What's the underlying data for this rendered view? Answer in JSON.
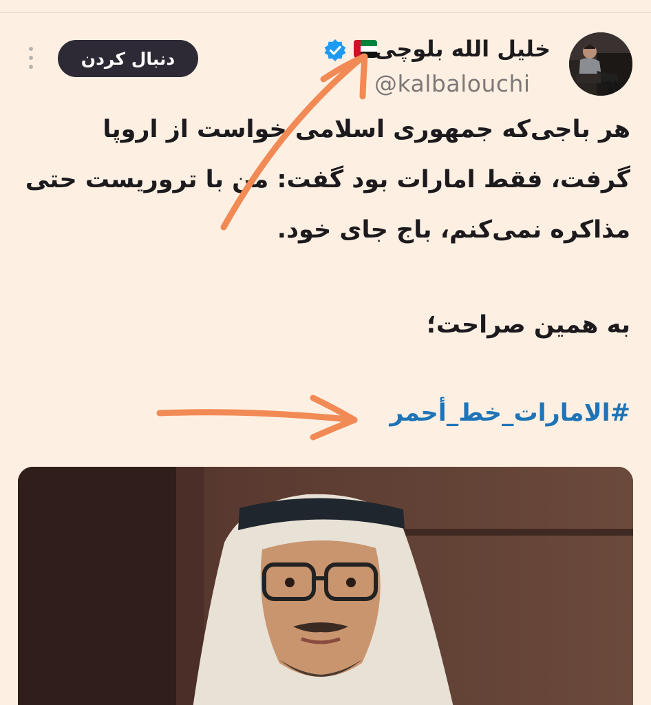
{
  "tweet": {
    "author": {
      "display_name": "خلیل الله بلوچی",
      "handle": "@kalbalouchi",
      "verified_icon": "verified-badge-icon",
      "flag_icon": "uae-flag-icon"
    },
    "follow_label": "دنبال کردن",
    "more_icon": "more-vertical-icon",
    "lines": [
      "هر باجی‌که جمهوری اسلامی خواست از اروپا",
      "گرفت، فقط امارات بود گفت: من با تروریست حتی",
      "مذاکره نمی‌کنم، باج جای خود."
    ],
    "second_paragraph": "به همین صراحت؛",
    "hashtag": "#الامارات_خط_أحمر"
  },
  "colors": {
    "background": "#fdf0e3",
    "text": "#1c1a1d",
    "handle": "#7d7877",
    "hashtag": "#1e74b7",
    "follow_button": "#2d2a35",
    "verified": "#1d9bf0",
    "annotation_arrow": "#f18a55"
  }
}
